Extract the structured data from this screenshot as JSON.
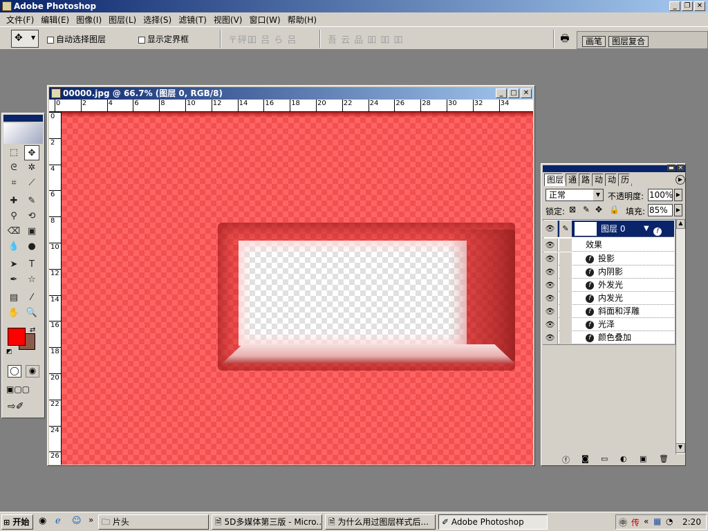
{
  "app": {
    "title": "Adobe Photoshop"
  },
  "menu": [
    "文件(F)",
    "编辑(E)",
    "图像(I)",
    "图层(L)",
    "选择(S)",
    "滤镜(T)",
    "视图(V)",
    "窗口(W)",
    "帮助(H)"
  ],
  "options": {
    "auto_select_label": "自动选择图层",
    "show_bounds_label": "显示定界框",
    "align_glyphs": "〒砰吅 吕 ら 吕",
    "distribute_glyphs": "吾 云 品  吅 吅 吅"
  },
  "palette_well": {
    "tab1": "画笔",
    "tab2": "图层复合"
  },
  "document": {
    "title": "00000.jpg @ 66.7% (图层 0, RGB/8)"
  },
  "rulers": {
    "h": [
      "0",
      "2",
      "4",
      "6",
      "8",
      "10",
      "12",
      "14",
      "16",
      "18",
      "20",
      "22",
      "24",
      "26",
      "28",
      "30",
      "32",
      "34"
    ],
    "v": [
      "0",
      "2",
      "4",
      "6",
      "8",
      "10",
      "12",
      "14",
      "16",
      "18",
      "20",
      "22",
      "24",
      "26"
    ]
  },
  "layers": {
    "tabs": [
      "图层",
      "通",
      "路",
      "动",
      "动",
      "历"
    ],
    "blend_mode": "正常",
    "opacity_label": "不透明度:",
    "opacity_value": "100%",
    "lock_label": "锁定:",
    "fill_label": "填充:",
    "fill_value": "85%",
    "layer_name": "图层 0",
    "effects_label": "效果",
    "effects": [
      "投影",
      "内阴影",
      "外发光",
      "内发光",
      "斜面和浮雕",
      "光泽",
      "颜色叠加"
    ]
  },
  "colors": {
    "foreground": "#ff0000",
    "background": "#8b5a4a"
  },
  "taskbar": {
    "start": "开始",
    "buttons": [
      "片头",
      "5D多媒体第三版 - Micro...",
      "为什么用过图层样式后...",
      "Adobe Photoshop"
    ],
    "clock": "2:20"
  }
}
